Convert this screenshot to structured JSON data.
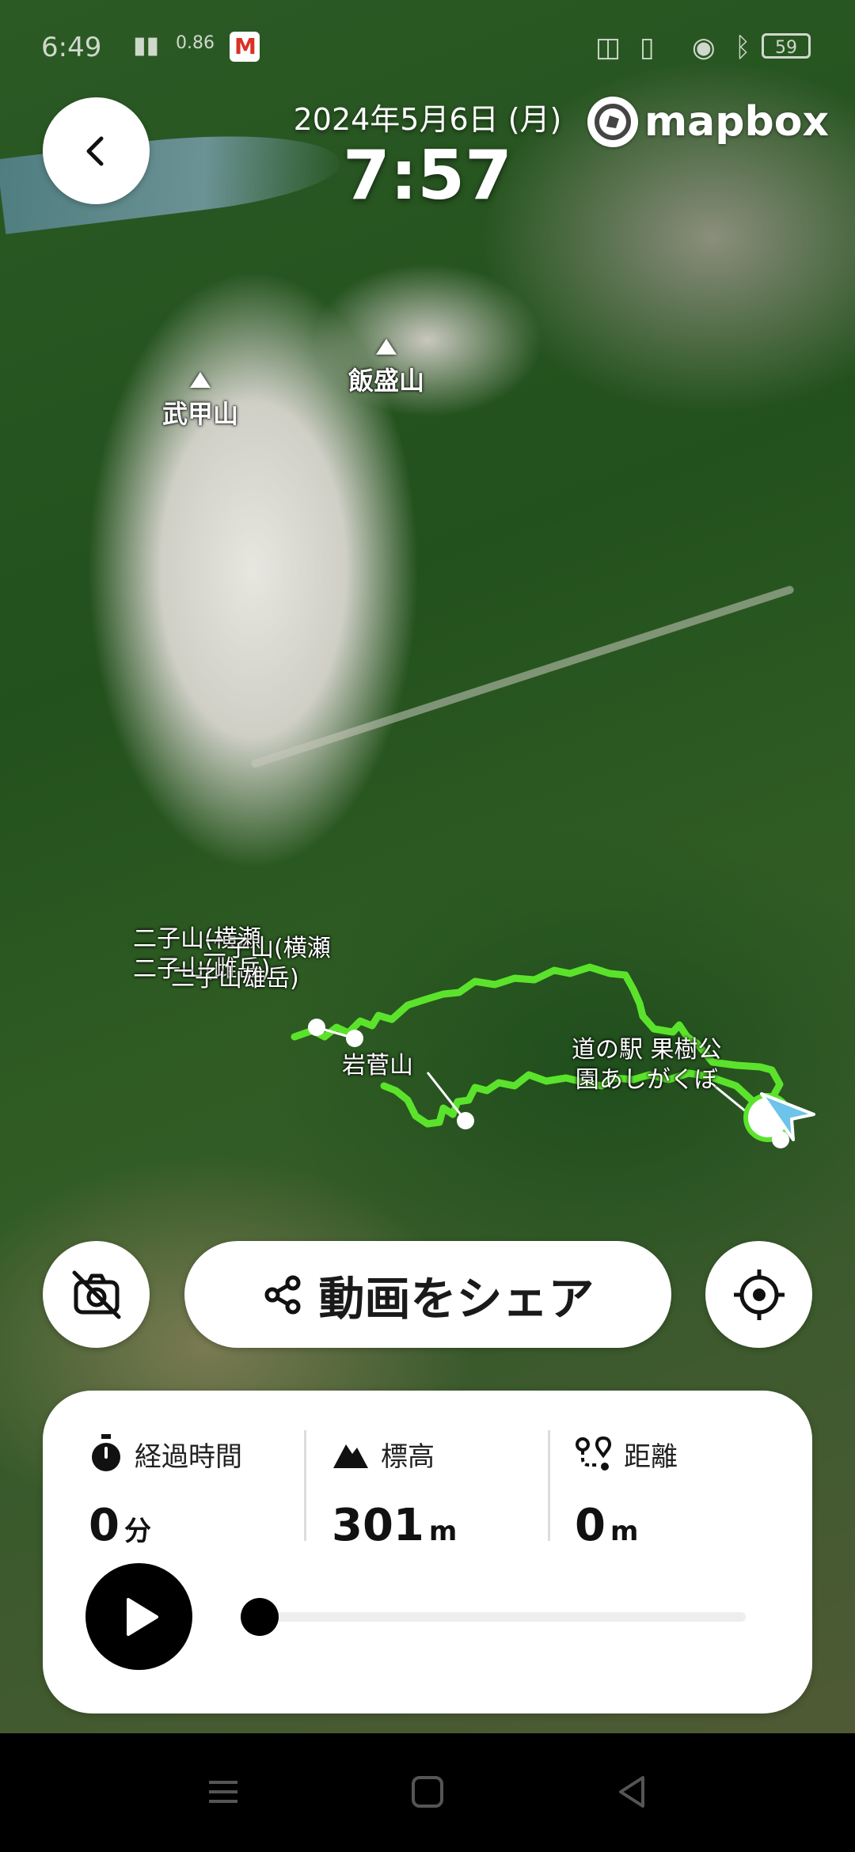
{
  "status_bar": {
    "time": "6:49",
    "network_speed": "0.86",
    "battery": "59"
  },
  "header": {
    "date": "2024年5月6日 (月)",
    "time": "7:57",
    "map_provider": "mapbox"
  },
  "map": {
    "peaks": [
      {
        "name": "武甲山"
      },
      {
        "name": "飯盛山"
      }
    ],
    "labels": {
      "futago_overlap_1": "二子山(横瀬",
      "futago_overlap_2": "二子山(横瀬",
      "futago_overlap_3": "二子山雄岳)",
      "futago_overlap_4": "二子山(雌岳)",
      "iwasuge": "岩菅山",
      "station_line1": "道の駅 果樹公",
      "station_line2": "園あしがくぼ"
    },
    "route_color": "#5be32c"
  },
  "controls": {
    "camera_off_icon": "camera-off-icon",
    "share_label": "動画をシェア",
    "locate_icon": "crosshair-icon"
  },
  "stats": {
    "elapsed": {
      "label": "経過時間",
      "value": "0",
      "unit": "分",
      "icon": "stopwatch-icon"
    },
    "elevation": {
      "label": "標高",
      "value": "301",
      "unit": "m",
      "icon": "mountain-icon"
    },
    "distance": {
      "label": "距離",
      "value": "0",
      "unit": "m",
      "icon": "route-pin-icon"
    }
  },
  "playback": {
    "progress": 0,
    "icon": "play-icon"
  },
  "nav_bar": {
    "items": [
      "menu-icon",
      "home-square-icon",
      "back-triangle-icon"
    ]
  }
}
